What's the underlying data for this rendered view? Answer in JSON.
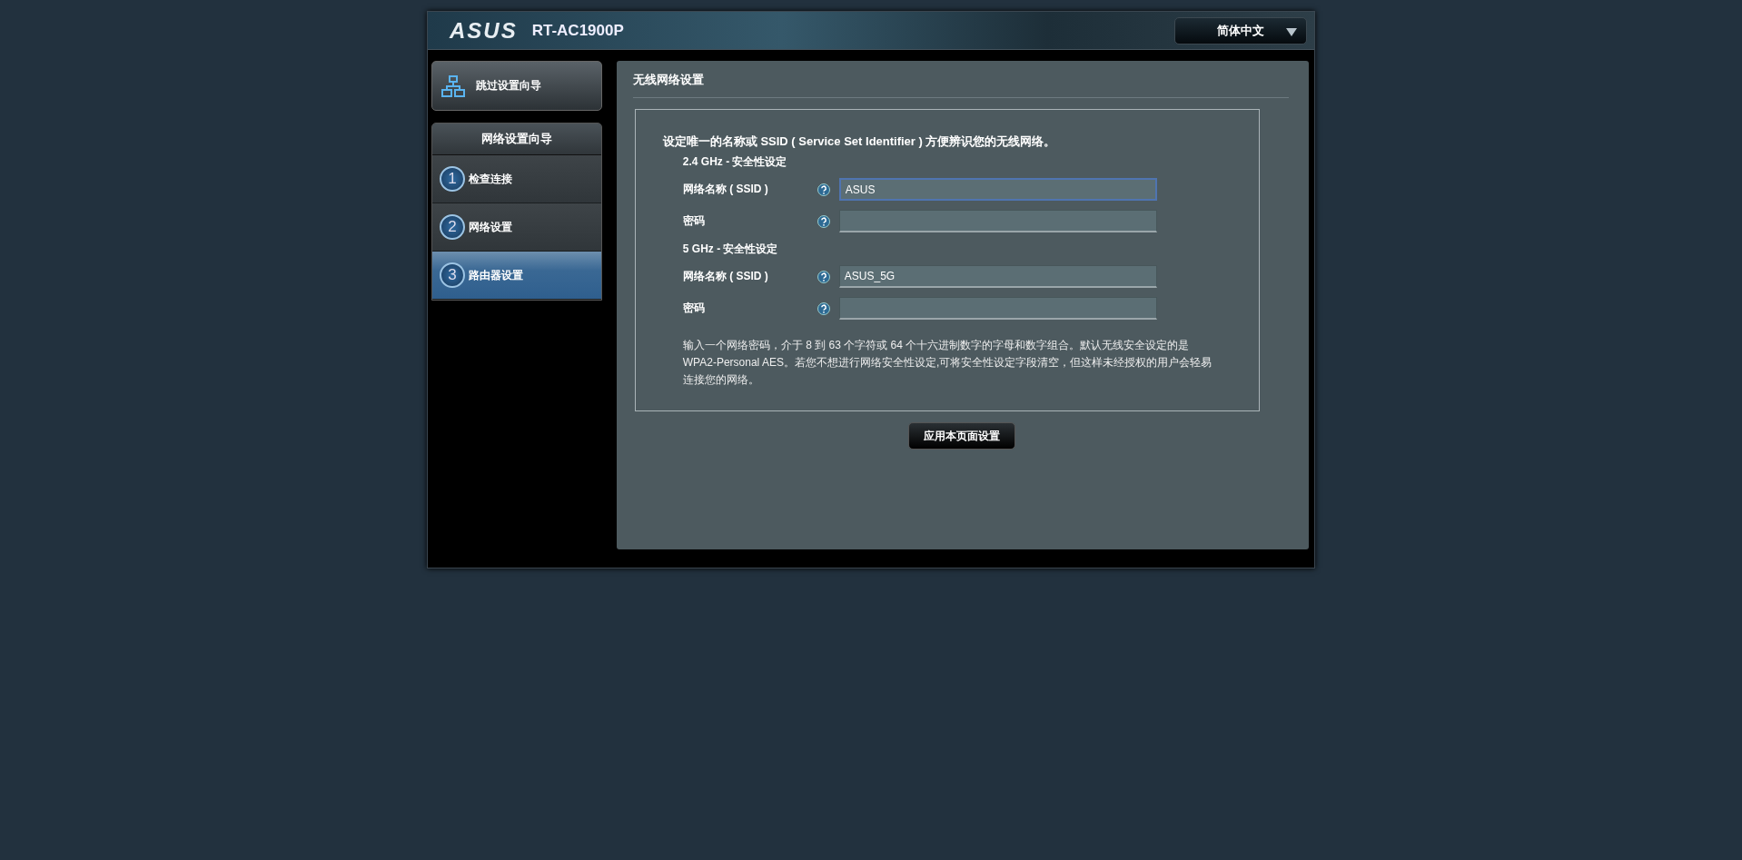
{
  "header": {
    "logo": "ASUS",
    "model": "RT-AC1900P",
    "language": "简体中文"
  },
  "sidebar": {
    "skip_button": "跳过设置向导",
    "wizard_title": "网络设置向导",
    "steps": [
      {
        "number": "1",
        "label": "检查连接",
        "selected": false
      },
      {
        "number": "2",
        "label": "网络设置",
        "selected": false
      },
      {
        "number": "3",
        "label": "路由器设置",
        "selected": true
      }
    ]
  },
  "panel": {
    "title": "无线网络设置",
    "intro": "设定唯一的名称或 SSID ( Service Set Identifier ) 方便辨识您的无线网络。",
    "bands": [
      {
        "heading": "2.4 GHz - 安全性设定",
        "fields": [
          {
            "label": "网络名称 ( SSID )",
            "value": "ASUS",
            "focused": true
          },
          {
            "label": "密码",
            "focused": false
          }
        ]
      },
      {
        "heading": "5 GHz - 安全性设定",
        "fields": [
          {
            "label": "网络名称 ( SSID )",
            "value": "ASUS_5G",
            "focused": false
          },
          {
            "label": "密码",
            "focused": false
          }
        ]
      }
    ],
    "note": "输入一个网络密码，介于 8 到 63 个字符或 64 个十六进制数字的字母和数字组合。默认无线安全设定的是 WPA2-Personal AES。若您不想进行网络安全性设定,可将安全性设定字段清空，但这样未经授权的用户会轻易连接您的网络。",
    "apply_button": "应用本页面设置"
  }
}
